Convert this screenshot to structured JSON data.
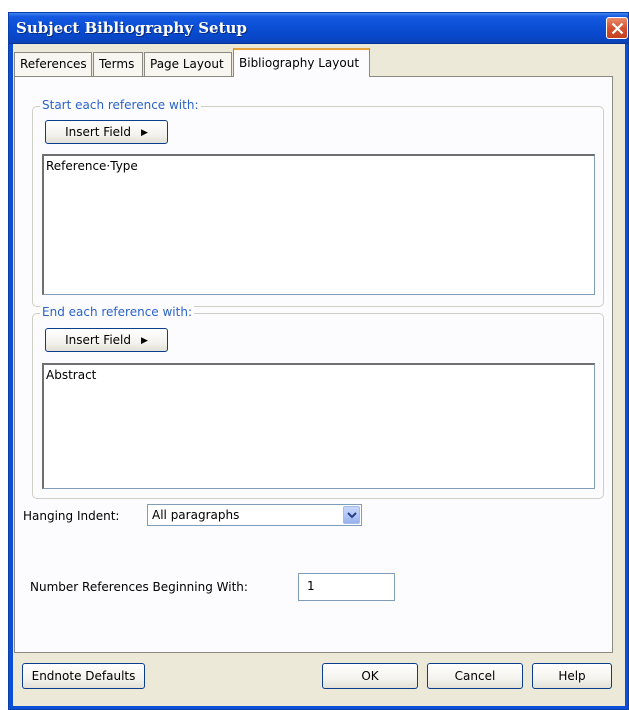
{
  "window": {
    "title": "Subject Bibliography Setup"
  },
  "tabs": [
    {
      "label": "References",
      "active": false
    },
    {
      "label": "Terms",
      "active": false
    },
    {
      "label": "Page Layout",
      "active": false
    },
    {
      "label": "Bibliography Layout",
      "active": true
    }
  ],
  "start_group": {
    "legend": "Start each reference with:",
    "insert_field_label": "Insert Field",
    "text": "Reference·Type"
  },
  "end_group": {
    "legend": "End each reference with:",
    "insert_field_label": "Insert Field",
    "text": "Abstract"
  },
  "hanging_indent": {
    "label": "Hanging Indent:",
    "selected": "All paragraphs"
  },
  "number_references": {
    "label": "Number References Beginning With:",
    "value": "1"
  },
  "buttons": {
    "endnote_defaults": "Endnote Defaults",
    "ok": "OK",
    "cancel": "Cancel",
    "help": "Help"
  },
  "icons": {
    "close": "close-icon",
    "submenu_arrow": "arrow-right-icon",
    "dropdown": "chevron-down-icon"
  },
  "colors": {
    "titlebar": "#0a4fd6",
    "legend_text": "#2b62c8",
    "dialog_bg": "#ece9d8",
    "close_button": "#d6522e"
  }
}
